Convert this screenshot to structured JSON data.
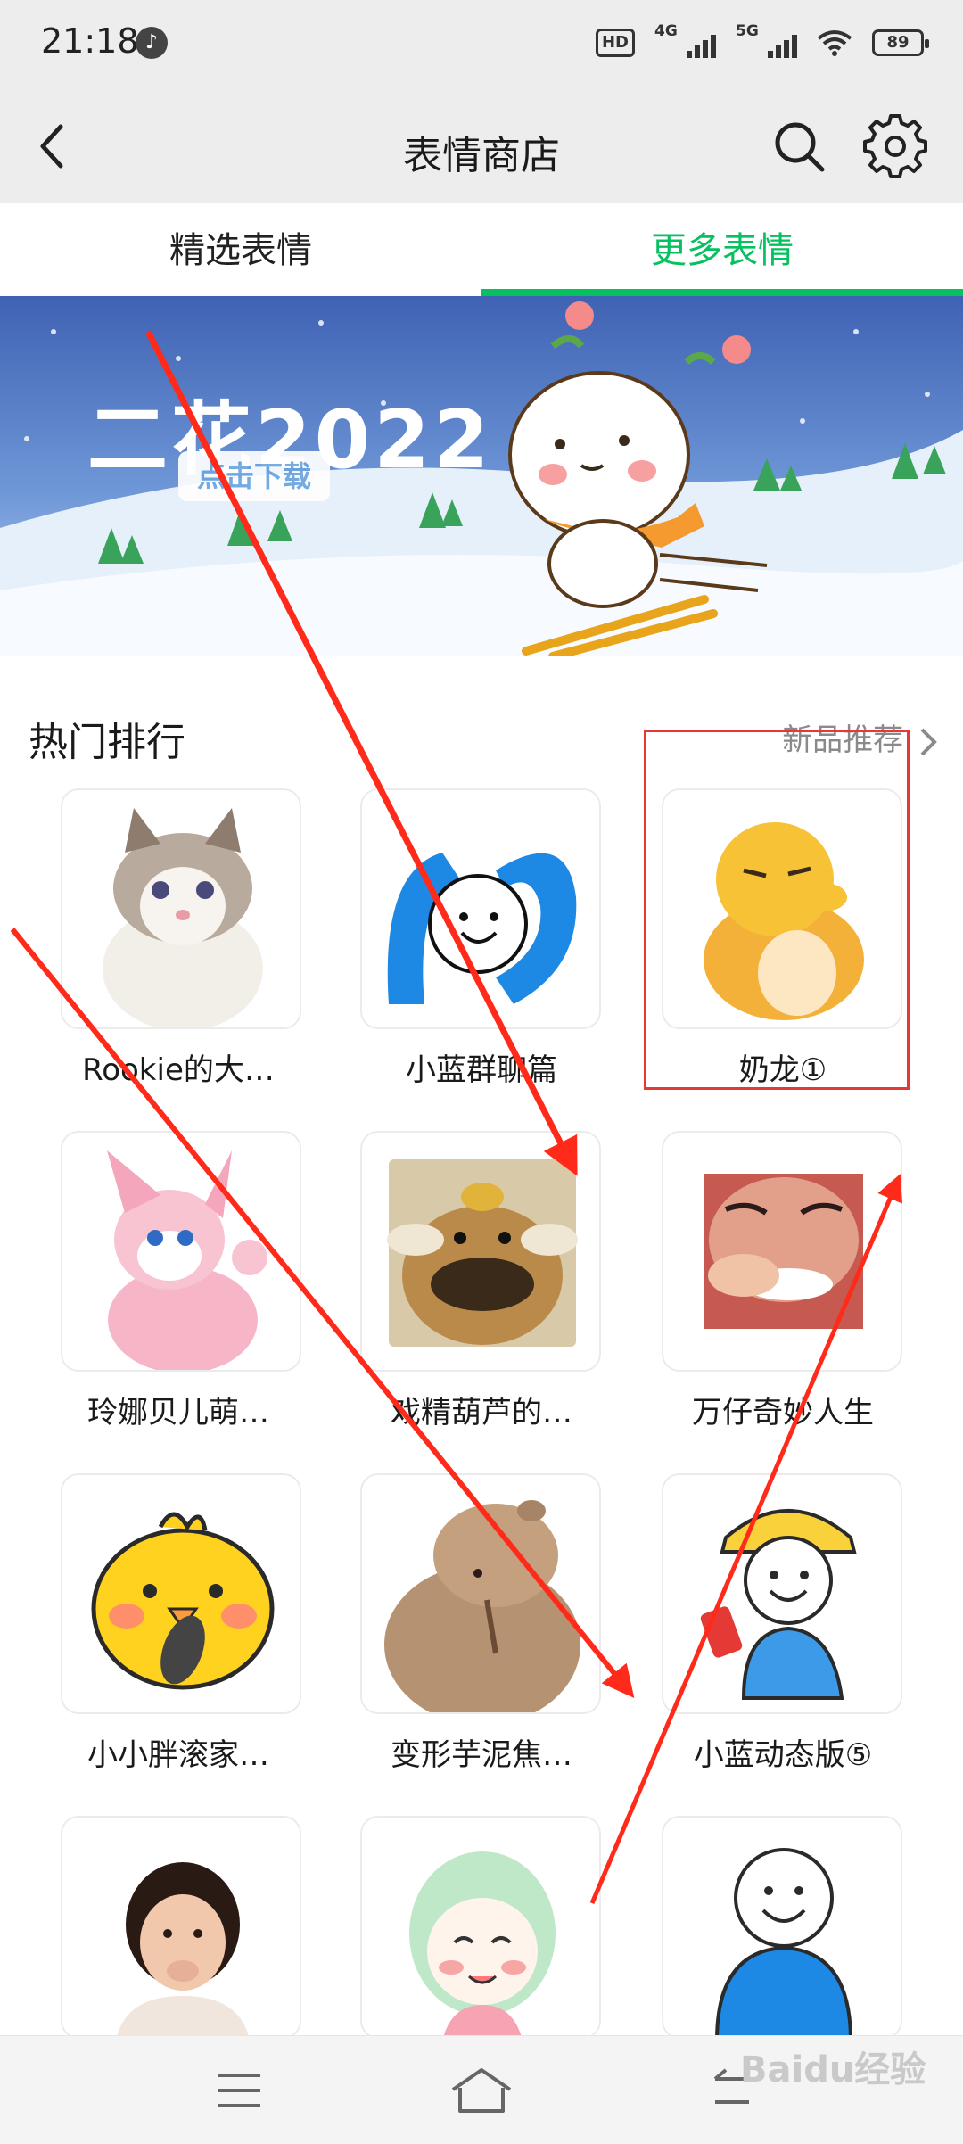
{
  "status_bar": {
    "time": "21:18",
    "music_glyph": "♪",
    "hd_badge": "HD",
    "signal_1": "4G",
    "signal_2": "5G",
    "battery": "89"
  },
  "header": {
    "title": "表情商店",
    "icons": [
      "back-icon",
      "search-icon",
      "gear-icon"
    ]
  },
  "tabs": [
    {
      "label": "精选表情",
      "active": false
    },
    {
      "label": "更多表情",
      "active": true
    }
  ],
  "banner": {
    "title": "二花2022",
    "button_label": "点击下载"
  },
  "section": {
    "title": "热门排行",
    "more_label": "新品推荐"
  },
  "stickers": [
    {
      "name": "Rookie的大…"
    },
    {
      "name": "小蓝群聊篇"
    },
    {
      "name": "奶龙①"
    },
    {
      "name": "玲娜贝儿萌…"
    },
    {
      "name": "戏精葫芦的…"
    },
    {
      "name": "万仔奇妙人生"
    },
    {
      "name": "小小胖滚家…"
    },
    {
      "name": "变形芋泥焦…"
    },
    {
      "name": "小蓝动态版⑤"
    }
  ],
  "watermark": "Baidu经验",
  "colors": {
    "accent": "#07c160",
    "annotation": "#e53935",
    "header_bg": "#ededed"
  }
}
